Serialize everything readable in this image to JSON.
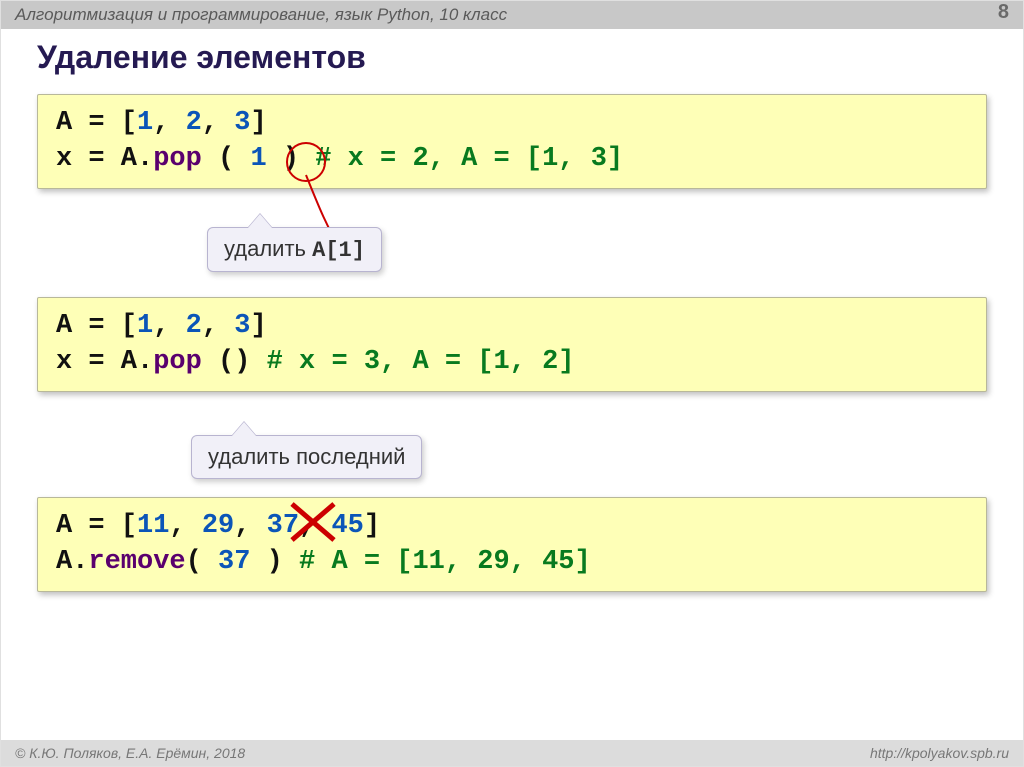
{
  "header": {
    "breadcrumb": "Алгоритмизация и программирование, язык Python, 10 класс",
    "page": "8"
  },
  "title": "Удаление элементов",
  "box1": {
    "line1_a": "A = [",
    "line1_n1": "1",
    "line1_c1": ", ",
    "line1_n2": "2",
    "line1_c2": ", ",
    "line1_n3": "3",
    "line1_b": "]",
    "line2_a": "x = A.",
    "line2_pop": "pop",
    "line2_paren": " ( ",
    "line2_arg": "1",
    "line2_paren2": " )   ",
    "line2_comment": "# x = 2, A = [1, 3]"
  },
  "label1": {
    "t1": "удалить ",
    "t2": "A[1]"
  },
  "box2": {
    "line1_a": "A = [",
    "line1_n1": "1",
    "line1_c1": ", ",
    "line1_n2": "2",
    "line1_c2": ", ",
    "line1_n3": "3",
    "line1_b": "]",
    "line2_a": "x = A.",
    "line2_pop": "pop",
    "line2_paren": " ()  ",
    "line2_comment": "# x = 3, A = [1, 2]"
  },
  "label2": {
    "t1": "удалить последний"
  },
  "box3": {
    "line1_a": "A = [",
    "line1_n1": "11",
    "line1_c1": ", ",
    "line1_n2": "29",
    "line1_c2": ", ",
    "line1_n3": "37",
    "line1_c3": ", ",
    "line1_n4": "45",
    "line1_b": "]",
    "line2_a": "A.",
    "line2_rem": "remove",
    "line2_paren": "( ",
    "line2_arg": "37",
    "line2_paren2": " )  ",
    "line2_comment": "# A = [11, 29, 45]"
  },
  "footer": {
    "left": "© К.Ю. Поляков, Е.А. Ерёмин, 2018",
    "right": "http://kpolyakov.spb.ru"
  }
}
